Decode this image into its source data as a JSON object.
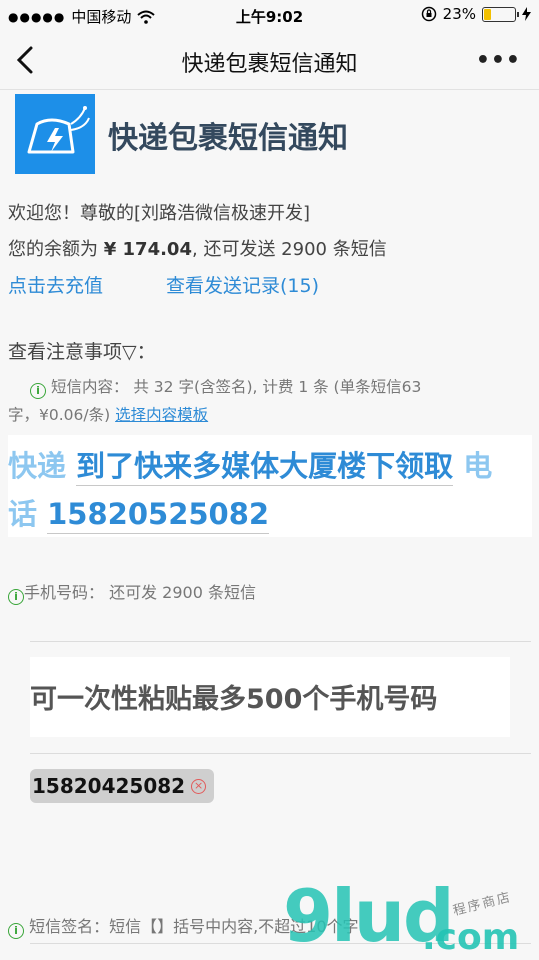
{
  "status": {
    "signal_dots": "●●●●●",
    "carrier": "中国移动",
    "time": "上午9:02",
    "battery": "23%",
    "battery_level": 0.23
  },
  "nav": {
    "title": "快递包裹短信通知",
    "more": "•••"
  },
  "app": {
    "title": "快递包裹短信通知"
  },
  "account": {
    "welcome": "欢迎您！尊敬的[刘路浩微信极速开发]",
    "balance_prefix": "您的余额为",
    "balance_value": "¥ 174.04",
    "balance_suffix": ", 还可发送 2900 条短信",
    "recharge_link": "点击去充值",
    "history_link": "查看发送记录(15)"
  },
  "notice": {
    "heading": "查看注意事项▽：",
    "info_icon": "i",
    "sms_info_line1": "短信内容： 共 32 字(含签名), 计费 1 条 (单条短信63",
    "sms_info_line2": "字，¥0.06/条)",
    "template_link": "选择内容模板"
  },
  "message": {
    "line1_fixed": "快递",
    "line1_edit": "到了快来多媒体大厦楼下领取",
    "line1_tail": "电",
    "line2_fixed": "话",
    "line2_edit": "15820525082"
  },
  "phones": {
    "label": "手机号码：  还可发 2900 条短信",
    "paste_placeholder": "可一次性粘贴最多500个手机号码",
    "chip_number": "15820425082",
    "chip_close": "×"
  },
  "signature": {
    "label": "短信签名：短信【】括号中内容,不超过10个字"
  },
  "watermark": {
    "main": "9lud",
    "com": ".com",
    "text": "程序商店"
  }
}
